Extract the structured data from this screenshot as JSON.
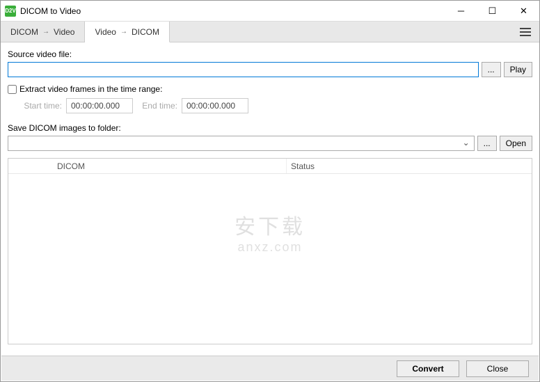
{
  "window": {
    "title": "DICOM to Video",
    "app_icon_text": "D2V"
  },
  "tabs": {
    "tab1_left": "DICOM",
    "tab1_right": "Video",
    "tab2_left": "Video",
    "tab2_right": "DICOM"
  },
  "source": {
    "label": "Source video file:",
    "value": "",
    "browse": "...",
    "play": "Play"
  },
  "extract": {
    "checkbox_label": "Extract video frames in the time range:",
    "start_label": "Start time:",
    "start_value": "00:00:00.000",
    "end_label": "End time:",
    "end_value": "00:00:00.000"
  },
  "save": {
    "label": "Save DICOM images to folder:",
    "value": "",
    "browse": "...",
    "open": "Open"
  },
  "list": {
    "col_dicom": "DICOM",
    "col_status": "Status"
  },
  "footer": {
    "convert": "Convert",
    "close": "Close"
  },
  "watermark": {
    "line1": "安下载",
    "line2": "anxz.com"
  }
}
